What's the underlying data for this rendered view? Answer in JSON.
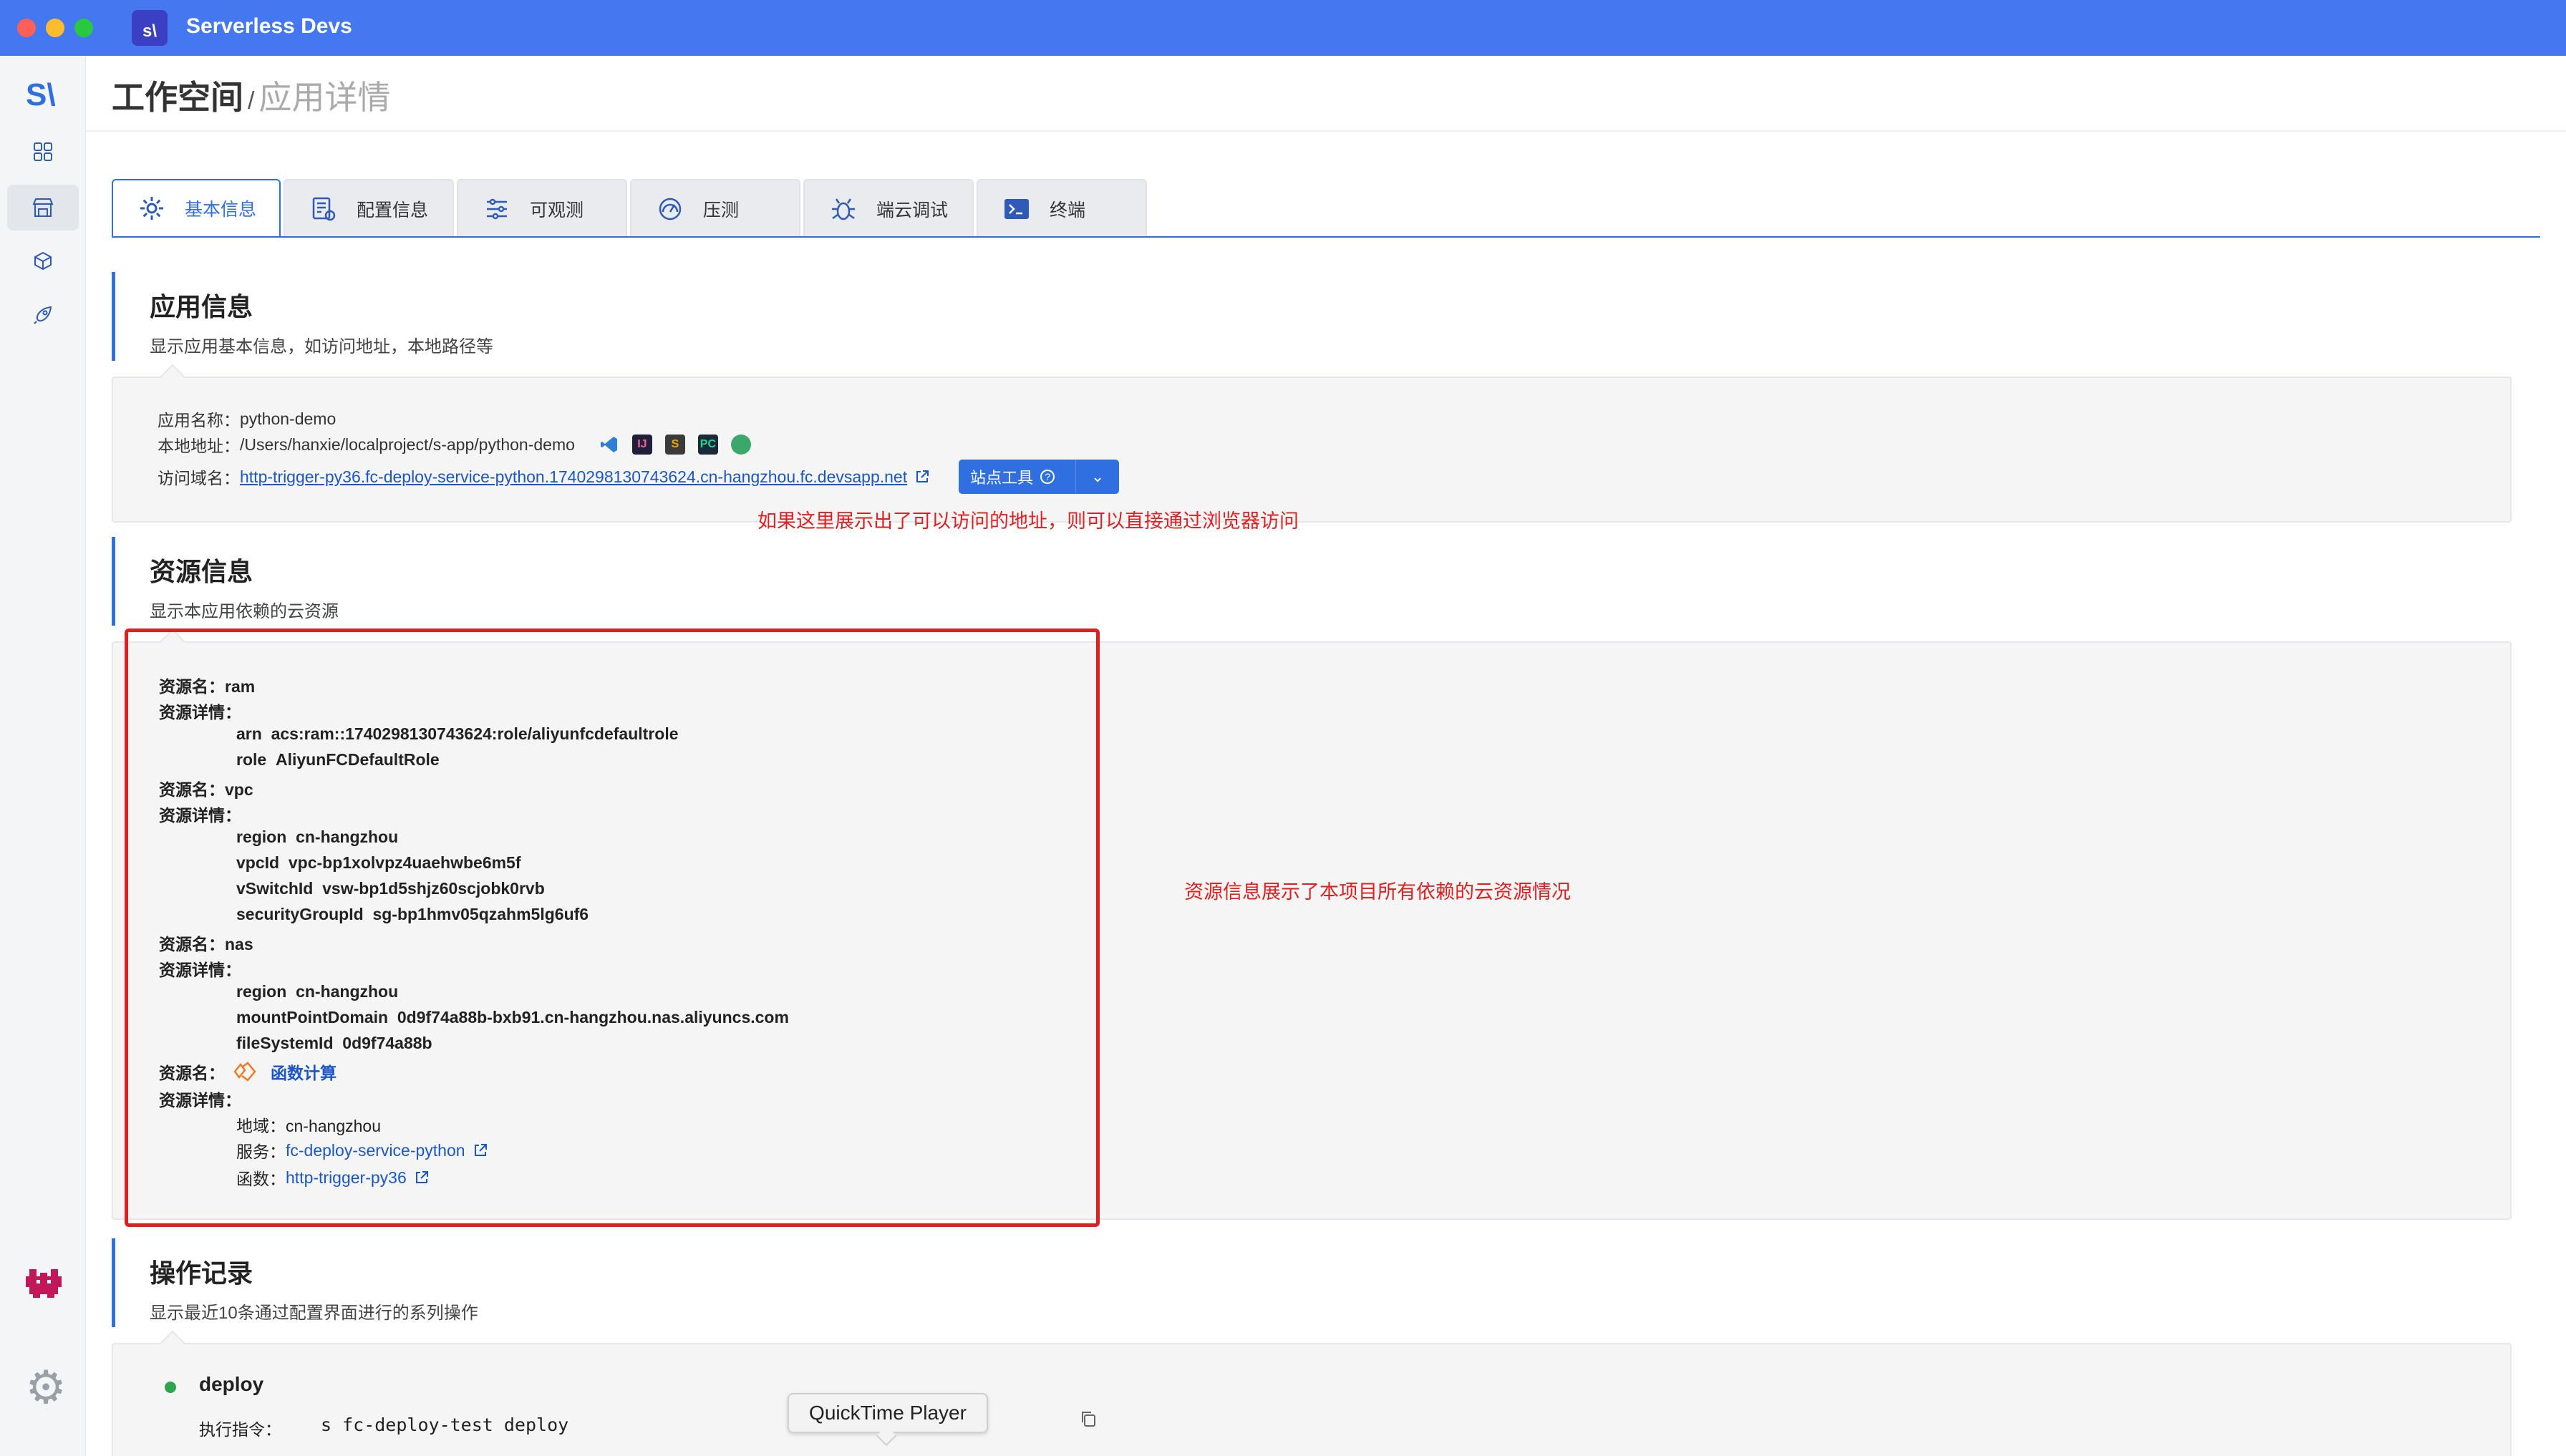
{
  "window": {
    "title": "Serverless Devs",
    "logo_text": "s\\"
  },
  "sidebar": {
    "logo_text": "S\\",
    "items": [
      {
        "name": "grid-icon"
      },
      {
        "name": "store-icon"
      },
      {
        "name": "cube-icon"
      },
      {
        "name": "rocket-icon"
      }
    ],
    "bottom_logo": "pixel-logo-icon",
    "settings": "gear-icon"
  },
  "breadcrumb": {
    "current": "工作空间",
    "separator": "/",
    "page": "应用详情"
  },
  "tabs": [
    {
      "label": "基本信息",
      "icon": "gear-icon",
      "active": true
    },
    {
      "label": "配置信息",
      "icon": "config-icon"
    },
    {
      "label": "可观测",
      "icon": "observe-icon"
    },
    {
      "label": "压测",
      "icon": "pressure-icon"
    },
    {
      "label": "端云调试",
      "icon": "debug-icon"
    },
    {
      "label": "终端",
      "icon": "terminal-icon"
    }
  ],
  "app_info": {
    "title": "应用信息",
    "subtitle": "显示应用基本信息，如访问地址，本地路径等",
    "name_label": "应用名称：",
    "name_value": "python-demo",
    "path_label": "本地地址：",
    "path_value": "/Users/hanxie/localproject/s-app/python-demo",
    "domain_label": "访问域名：",
    "domain_value": "http-trigger-py36.fc-deploy-service-python.1740298130743624.cn-hangzhou.fc.devsapp.net",
    "site_tools_label": "站点工具"
  },
  "annotations": {
    "access_hint": "如果这里展示出了可以访问的地址，则可以直接通过浏览器访问",
    "resource_hint": "资源信息展示了本项目所有依赖的云资源情况"
  },
  "resource_info": {
    "title": "资源信息",
    "subtitle": "显示本应用依赖的云资源",
    "name_label": "资源名：",
    "detail_label": "资源详情：",
    "ram": {
      "name": "ram",
      "arn_key": "arn",
      "arn_value": "acs:ram::1740298130743624:role/aliyunfcdefaultrole",
      "role_key": "role",
      "role_value": "AliyunFCDefaultRole"
    },
    "vpc": {
      "name": "vpc",
      "region_key": "region",
      "region_value": "cn-hangzhou",
      "vpcid_key": "vpcId",
      "vpcid_value": "vpc-bp1xolvpz4uaehwbe6m5f",
      "vswitch_key": "vSwitchId",
      "vswitch_value": "vsw-bp1d5shjz60scjobk0rvb",
      "sg_key": "securityGroupId",
      "sg_value": "sg-bp1hmv05qzahm5lg6uf6"
    },
    "nas": {
      "name": "nas",
      "region_key": "region",
      "region_value": "cn-hangzhou",
      "mount_key": "mountPointDomain",
      "mount_value": "0d9f74a88b-bxb91.cn-hangzhou.nas.aliyuncs.com",
      "fs_key": "fileSystemId",
      "fs_value": "0d9f74a88b"
    },
    "fc": {
      "name": "函数计算",
      "region_key": "地域：",
      "region_value": "cn-hangzhou",
      "service_key": "服务：",
      "service_value": "fc-deploy-service-python",
      "function_key": "函数：",
      "function_value": "http-trigger-py36"
    }
  },
  "operations": {
    "title": "操作记录",
    "subtitle": "显示最近10条通过配置界面进行的系列操作",
    "items": [
      {
        "name": "deploy",
        "cmd_label": "执行指令：",
        "cmd": "s fc-deploy-test deploy"
      }
    ]
  },
  "tooltip": {
    "text": "QuickTime Player"
  },
  "colors": {
    "accent": "#2f6fe0",
    "titlebar": "#4578f0",
    "annotation": "#e02020",
    "link": "#1a56c8"
  }
}
